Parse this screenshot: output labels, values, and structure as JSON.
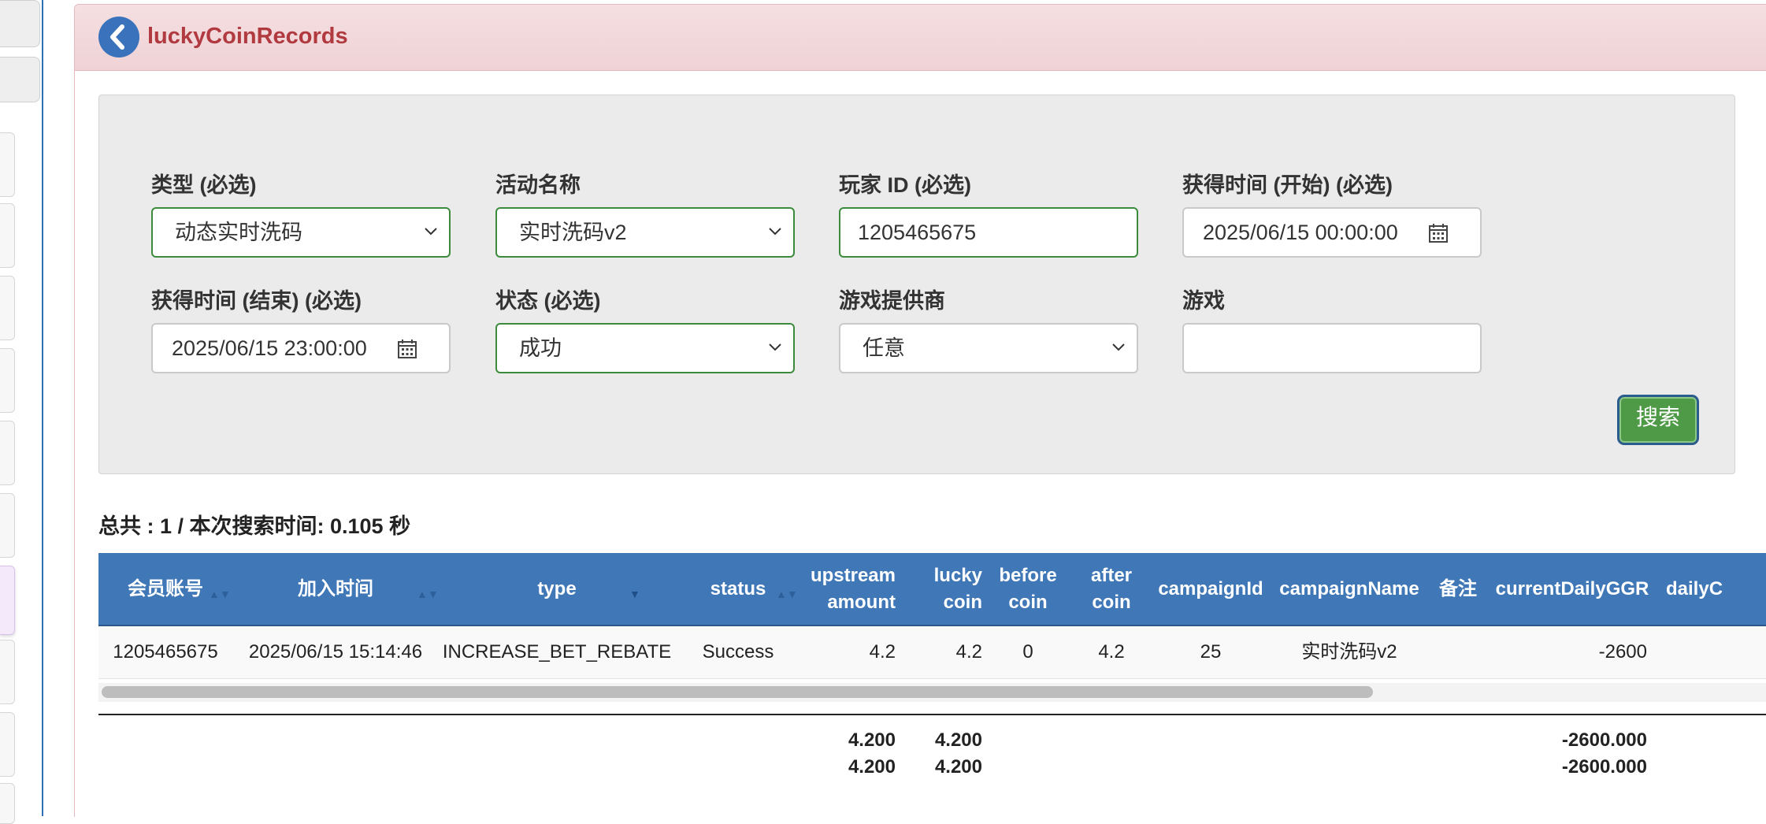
{
  "header": {
    "title": "luckyCoinRecords"
  },
  "filters": {
    "type": {
      "label": "类型 (必选)",
      "value": "动态实时洗码"
    },
    "campaign": {
      "label": "活动名称",
      "value": "实时洗码v2"
    },
    "player_id": {
      "label": "玩家 ID (必选)",
      "value": "1205465675"
    },
    "start_time": {
      "label": "获得时间 (开始) (必选)",
      "value": "2025/06/15 00:00:00"
    },
    "end_time": {
      "label": "获得时间 (结束) (必选)",
      "value": "2025/06/15 23:00:00"
    },
    "status": {
      "label": "状态 (必选)",
      "value": "成功"
    },
    "provider": {
      "label": "游戏提供商",
      "value": "任意"
    },
    "game": {
      "label": "游戏",
      "value": ""
    },
    "search_label": "搜索"
  },
  "summary": "总共 : 1 / 本次搜索时间: 0.105 秒",
  "table": {
    "columns": [
      {
        "label": "会员账号"
      },
      {
        "label": "加入时间"
      },
      {
        "label": "type"
      },
      {
        "label": "status"
      },
      {
        "label": "upstream amount"
      },
      {
        "label": "lucky coin"
      },
      {
        "label": "before coin"
      },
      {
        "label": "after coin"
      },
      {
        "label": "campaignId"
      },
      {
        "label": "campaignName"
      },
      {
        "label": "备注"
      },
      {
        "label": "currentDailyGGR"
      },
      {
        "label": "dailyC"
      }
    ],
    "rows": [
      {
        "member": "1205465675",
        "join_time": "2025/06/15 15:14:46",
        "type": "INCREASE_BET_REBATE",
        "status": "Success",
        "upstream_amount": "4.2",
        "lucky_coin": "4.2",
        "before_coin": "0",
        "after_coin": "4.2",
        "campaign_id": "25",
        "campaign_name": "实时洗码v2",
        "remark": "",
        "current_daily_ggr": "-2600"
      }
    ],
    "totals": [
      {
        "upstream_amount": "4.200",
        "lucky_coin": "4.200",
        "current_daily_ggr": "-2600.000"
      },
      {
        "upstream_amount": "4.200",
        "lucky_coin": "4.200",
        "current_daily_ggr": "-2600.000"
      }
    ]
  },
  "colors": {
    "header_bg": "#efd2d5",
    "title": "#b03a3f",
    "table_header": "#3f77b7",
    "search_button": "#4e9a47",
    "valid_border": "#3c8b3c"
  }
}
